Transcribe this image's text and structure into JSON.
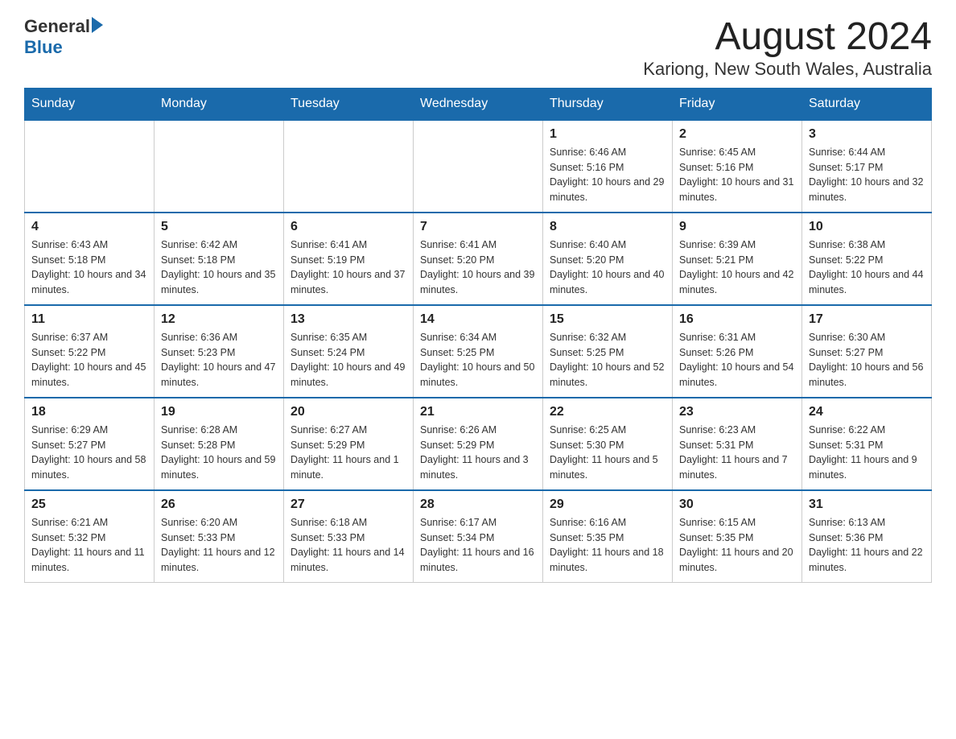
{
  "header": {
    "logo": {
      "general": "General",
      "blue": "Blue"
    },
    "month_title": "August 2024",
    "location": "Kariong, New South Wales, Australia"
  },
  "days_of_week": [
    "Sunday",
    "Monday",
    "Tuesday",
    "Wednesday",
    "Thursday",
    "Friday",
    "Saturday"
  ],
  "weeks": [
    [
      {
        "day": "",
        "info": ""
      },
      {
        "day": "",
        "info": ""
      },
      {
        "day": "",
        "info": ""
      },
      {
        "day": "",
        "info": ""
      },
      {
        "day": "1",
        "info": "Sunrise: 6:46 AM\nSunset: 5:16 PM\nDaylight: 10 hours and 29 minutes."
      },
      {
        "day": "2",
        "info": "Sunrise: 6:45 AM\nSunset: 5:16 PM\nDaylight: 10 hours and 31 minutes."
      },
      {
        "day": "3",
        "info": "Sunrise: 6:44 AM\nSunset: 5:17 PM\nDaylight: 10 hours and 32 minutes."
      }
    ],
    [
      {
        "day": "4",
        "info": "Sunrise: 6:43 AM\nSunset: 5:18 PM\nDaylight: 10 hours and 34 minutes."
      },
      {
        "day": "5",
        "info": "Sunrise: 6:42 AM\nSunset: 5:18 PM\nDaylight: 10 hours and 35 minutes."
      },
      {
        "day": "6",
        "info": "Sunrise: 6:41 AM\nSunset: 5:19 PM\nDaylight: 10 hours and 37 minutes."
      },
      {
        "day": "7",
        "info": "Sunrise: 6:41 AM\nSunset: 5:20 PM\nDaylight: 10 hours and 39 minutes."
      },
      {
        "day": "8",
        "info": "Sunrise: 6:40 AM\nSunset: 5:20 PM\nDaylight: 10 hours and 40 minutes."
      },
      {
        "day": "9",
        "info": "Sunrise: 6:39 AM\nSunset: 5:21 PM\nDaylight: 10 hours and 42 minutes."
      },
      {
        "day": "10",
        "info": "Sunrise: 6:38 AM\nSunset: 5:22 PM\nDaylight: 10 hours and 44 minutes."
      }
    ],
    [
      {
        "day": "11",
        "info": "Sunrise: 6:37 AM\nSunset: 5:22 PM\nDaylight: 10 hours and 45 minutes."
      },
      {
        "day": "12",
        "info": "Sunrise: 6:36 AM\nSunset: 5:23 PM\nDaylight: 10 hours and 47 minutes."
      },
      {
        "day": "13",
        "info": "Sunrise: 6:35 AM\nSunset: 5:24 PM\nDaylight: 10 hours and 49 minutes."
      },
      {
        "day": "14",
        "info": "Sunrise: 6:34 AM\nSunset: 5:25 PM\nDaylight: 10 hours and 50 minutes."
      },
      {
        "day": "15",
        "info": "Sunrise: 6:32 AM\nSunset: 5:25 PM\nDaylight: 10 hours and 52 minutes."
      },
      {
        "day": "16",
        "info": "Sunrise: 6:31 AM\nSunset: 5:26 PM\nDaylight: 10 hours and 54 minutes."
      },
      {
        "day": "17",
        "info": "Sunrise: 6:30 AM\nSunset: 5:27 PM\nDaylight: 10 hours and 56 minutes."
      }
    ],
    [
      {
        "day": "18",
        "info": "Sunrise: 6:29 AM\nSunset: 5:27 PM\nDaylight: 10 hours and 58 minutes."
      },
      {
        "day": "19",
        "info": "Sunrise: 6:28 AM\nSunset: 5:28 PM\nDaylight: 10 hours and 59 minutes."
      },
      {
        "day": "20",
        "info": "Sunrise: 6:27 AM\nSunset: 5:29 PM\nDaylight: 11 hours and 1 minute."
      },
      {
        "day": "21",
        "info": "Sunrise: 6:26 AM\nSunset: 5:29 PM\nDaylight: 11 hours and 3 minutes."
      },
      {
        "day": "22",
        "info": "Sunrise: 6:25 AM\nSunset: 5:30 PM\nDaylight: 11 hours and 5 minutes."
      },
      {
        "day": "23",
        "info": "Sunrise: 6:23 AM\nSunset: 5:31 PM\nDaylight: 11 hours and 7 minutes."
      },
      {
        "day": "24",
        "info": "Sunrise: 6:22 AM\nSunset: 5:31 PM\nDaylight: 11 hours and 9 minutes."
      }
    ],
    [
      {
        "day": "25",
        "info": "Sunrise: 6:21 AM\nSunset: 5:32 PM\nDaylight: 11 hours and 11 minutes."
      },
      {
        "day": "26",
        "info": "Sunrise: 6:20 AM\nSunset: 5:33 PM\nDaylight: 11 hours and 12 minutes."
      },
      {
        "day": "27",
        "info": "Sunrise: 6:18 AM\nSunset: 5:33 PM\nDaylight: 11 hours and 14 minutes."
      },
      {
        "day": "28",
        "info": "Sunrise: 6:17 AM\nSunset: 5:34 PM\nDaylight: 11 hours and 16 minutes."
      },
      {
        "day": "29",
        "info": "Sunrise: 6:16 AM\nSunset: 5:35 PM\nDaylight: 11 hours and 18 minutes."
      },
      {
        "day": "30",
        "info": "Sunrise: 6:15 AM\nSunset: 5:35 PM\nDaylight: 11 hours and 20 minutes."
      },
      {
        "day": "31",
        "info": "Sunrise: 6:13 AM\nSunset: 5:36 PM\nDaylight: 11 hours and 22 minutes."
      }
    ]
  ]
}
